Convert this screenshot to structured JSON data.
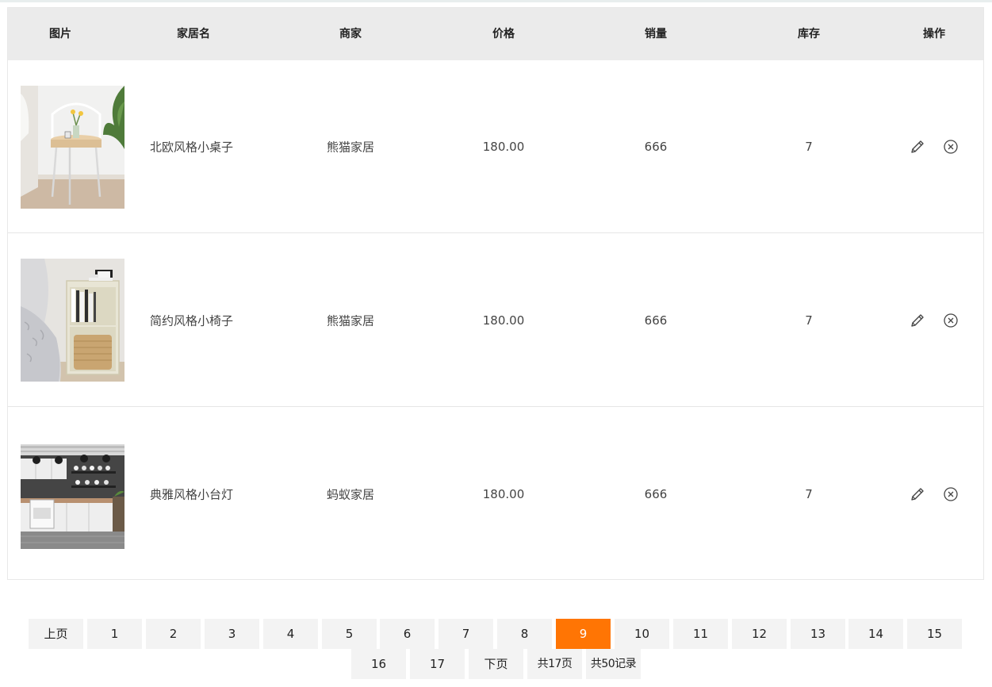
{
  "table": {
    "headers": {
      "image": "图片",
      "name": "家居名",
      "merchant": "商家",
      "price": "价格",
      "sales": "销量",
      "stock": "库存",
      "actions": "操作"
    },
    "rows": [
      {
        "name": "北欧风格小桌子",
        "merchant": "熊猫家居",
        "price": "180.00",
        "sales": "666",
        "stock": "7"
      },
      {
        "name": "简约风格小椅子",
        "merchant": "熊猫家居",
        "price": "180.00",
        "sales": "666",
        "stock": "7"
      },
      {
        "name": "典雅风格小台灯",
        "merchant": "蚂蚁家居",
        "price": "180.00",
        "sales": "666",
        "stock": "7"
      }
    ],
    "action_icons": [
      "pencil-icon",
      "close-circle-icon"
    ]
  },
  "pagination": {
    "prev": "上页",
    "pages": [
      "1",
      "2",
      "3",
      "4",
      "5",
      "6",
      "7",
      "8",
      "9",
      "10",
      "11",
      "12",
      "13",
      "14",
      "15",
      "16",
      "17"
    ],
    "current": "9",
    "next": "下页",
    "total_pages": "共17页",
    "total_records": "共50记录",
    "accent_color": "#ff7504"
  }
}
